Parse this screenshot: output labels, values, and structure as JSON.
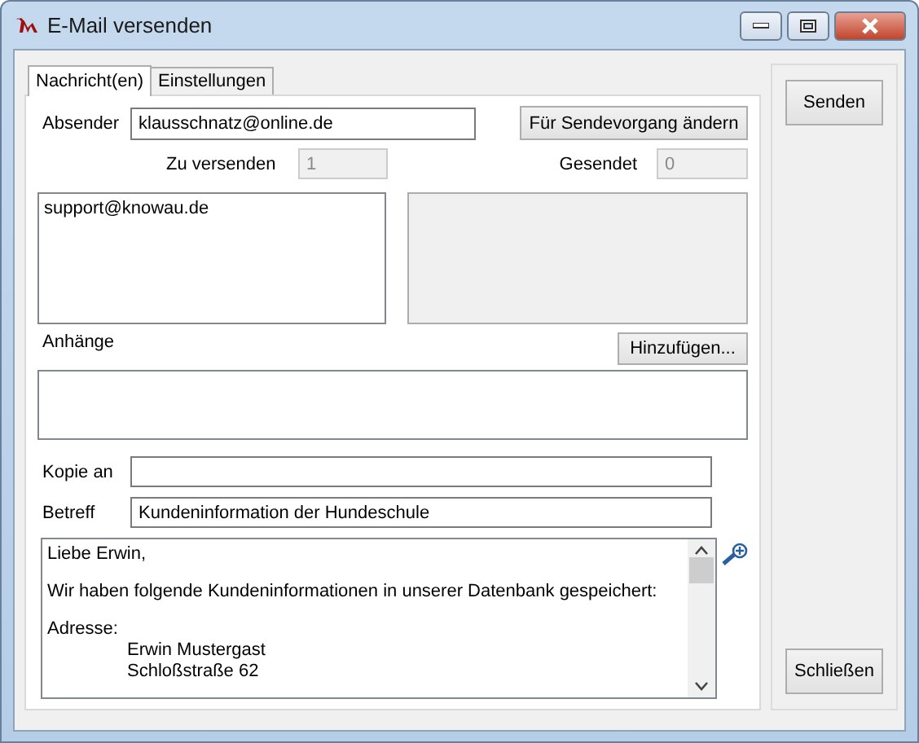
{
  "window": {
    "title": "E-Mail versenden"
  },
  "tabs": [
    {
      "label": "Nachricht(en)",
      "selected": true
    },
    {
      "label": "Einstellungen",
      "selected": false
    }
  ],
  "sender": {
    "label": "Absender",
    "value": "klausschnatz@online.de",
    "button": "Für Sendevorgang ändern"
  },
  "to_send": {
    "label": "Zu versenden",
    "value": "1",
    "disabled": true
  },
  "sent": {
    "label": "Gesendet",
    "value": "0",
    "disabled": true
  },
  "recipients": [
    "support@knowau.de"
  ],
  "attachments": {
    "label": "Anhänge",
    "button": "Hinzufügen..."
  },
  "cc": {
    "label": "Kopie an"
  },
  "subject": {
    "label": "Betreff",
    "value": "Kundeninformation der Hundeschule"
  },
  "message": [
    {
      "kind": "line",
      "text": "Liebe Erwin,"
    },
    {
      "kind": "gap"
    },
    {
      "kind": "line",
      "text": "Wir haben folgende Kundeninformationen in unserer Datenbank gespeichert:"
    },
    {
      "kind": "gap"
    },
    {
      "kind": "line",
      "text": "Adresse:"
    },
    {
      "kind": "indented",
      "text": "Erwin Mustergast"
    },
    {
      "kind": "indented",
      "text": "Schloßstraße 62"
    }
  ],
  "buttons": [
    {
      "kind": "send",
      "label": "Senden"
    },
    {
      "kind": "close",
      "label": "Schließen"
    }
  ]
}
